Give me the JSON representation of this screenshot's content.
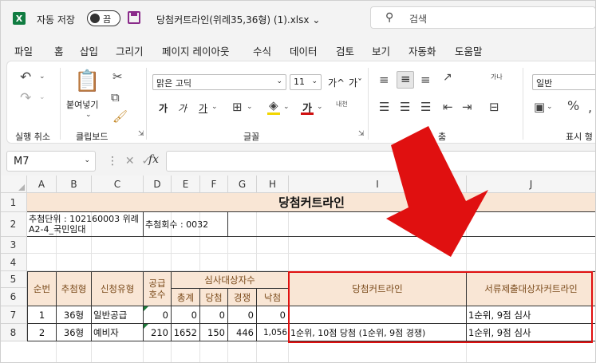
{
  "titlebar": {
    "app_logo": "X",
    "autosave_label": "자동 저장",
    "autosave_state": "끔",
    "file_title": "당첨커트라인(위례35,36형) (1).xlsx",
    "search_placeholder": "검색"
  },
  "menu": [
    "파일",
    "홈",
    "삽입",
    "그리기",
    "페이지 레이아웃",
    "수식",
    "데이터",
    "검토",
    "보기",
    "자동화",
    "도움말"
  ],
  "menu_active": "홈",
  "ribbon": {
    "undo_group": "실행 취소",
    "clipboard_group": "클립보드",
    "paste_label": "붙여넣기",
    "font_group": "글꼴",
    "font_name": "맑은 고딕",
    "font_size": "11",
    "align_group_tail": "춤",
    "number_format": "일반",
    "number_group": "표시 형",
    "bold": "가",
    "italic": "가",
    "underline": "가",
    "grow_font": "가^",
    "shrink_font": "가ˇ",
    "font_color_label": "가",
    "phonetic": "내천",
    "wrap_label": "가나"
  },
  "formula_bar": {
    "name_box": "M7",
    "fx": "fx",
    "formula": ""
  },
  "sheet": {
    "columns": [
      "A",
      "B",
      "C",
      "D",
      "E",
      "F",
      "G",
      "H",
      "I",
      "J"
    ],
    "rows": [
      "1",
      "2",
      "3",
      "4",
      "5",
      "6",
      "7",
      "8"
    ],
    "title": "당첨커트라인",
    "r2_a": "추첨단위 : 102160003 위례A2-4_국민임대",
    "r2_d": "추첨회수 : 0032",
    "headers": {
      "a": "순번",
      "b": "추첨형",
      "c": "신청유형",
      "d": "공급호수",
      "e_h": "심사대상자수",
      "e": "총계",
      "f": "당첨",
      "g": "경쟁",
      "h": "낙첨",
      "i": "당첨커트라인",
      "j": "서류제출대상자커트라인"
    },
    "data_rows": [
      {
        "a": "1",
        "b": "36형",
        "c": "일반공급",
        "d": "0",
        "e": "0",
        "f": "0",
        "g": "0",
        "h": "0",
        "i": "",
        "j": "1순위, 9점  심사"
      },
      {
        "a": "2",
        "b": "36형",
        "c": "예비자",
        "d": "210",
        "e": "1652",
        "f": "150",
        "g": "446",
        "h": "1,056",
        "i": "1순위, 10점  당첨 (1순위, 9점  경쟁)",
        "j": "1순위, 9점  심사"
      }
    ]
  },
  "colors": {
    "excel_green": "#107c41",
    "header_fill": "#f9e6d5",
    "highlight_red": "#e01010"
  }
}
